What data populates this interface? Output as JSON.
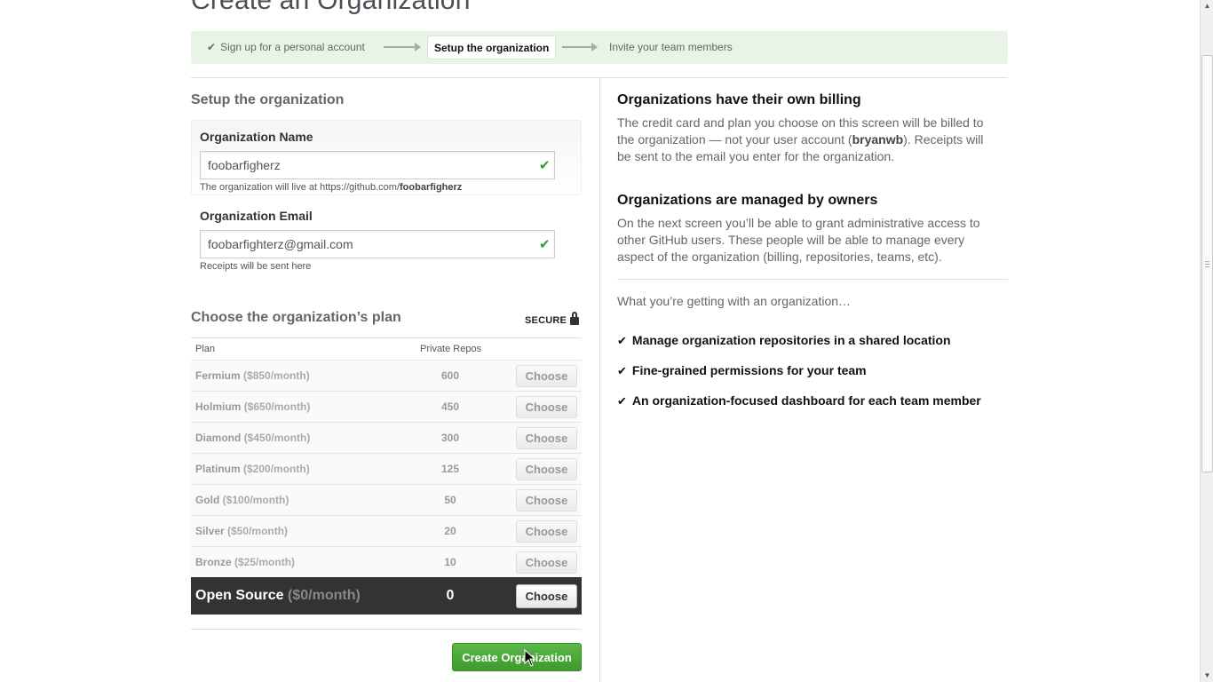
{
  "page": {
    "title": "Create an Organization"
  },
  "steps": {
    "step1": "Sign up for a personal account",
    "step2": "Setup the organization",
    "step3": "Invite your team members"
  },
  "setup": {
    "heading": "Setup the organization",
    "org_name": {
      "label": "Organization Name",
      "value": "foobarfigherz",
      "note_prefix": "The organization will live at https://github.com/",
      "note_slug": "foobarfigherz"
    },
    "org_email": {
      "label": "Organization Email",
      "value": "foobarfighterz@gmail.com",
      "note": "Receipts will be sent here"
    }
  },
  "plans": {
    "heading": "Choose the organization’s plan",
    "secure_label": "SECURE",
    "col_plan": "Plan",
    "col_repos": "Private Repos",
    "choose_label": "Choose",
    "rows": [
      {
        "name": "Fermium",
        "price": "($850/month)",
        "repos": "600"
      },
      {
        "name": "Holmium",
        "price": "($650/month)",
        "repos": "450"
      },
      {
        "name": "Diamond",
        "price": "($450/month)",
        "repos": "300"
      },
      {
        "name": "Platinum",
        "price": "($200/month)",
        "repos": "125"
      },
      {
        "name": "Gold",
        "price": "($100/month)",
        "repos": "50"
      },
      {
        "name": "Silver",
        "price": "($50/month)",
        "repos": "20"
      },
      {
        "name": "Bronze",
        "price": "($25/month)",
        "repos": "10"
      },
      {
        "name": "Open Source",
        "price": "($0/month)",
        "repos": "0"
      }
    ],
    "create_label": "Create Organization"
  },
  "info": {
    "billing_heading": "Organizations have their own billing",
    "billing_text_1": "The credit card and plan you choose on this screen will be billed to the organization — not your user account (",
    "billing_user": "bryanwb",
    "billing_text_2": "). Receipts will be sent to the email you enter for the organization.",
    "owners_heading": "Organizations are managed by owners",
    "owners_text": "On the next screen you’ll be able to grant administrative access to other GitHub users. These people will be able to manage every aspect of the organization (billing, repositories, teams, etc).",
    "getting": "What you’re getting with an organization…",
    "features": [
      "Manage organization repositories in a shared location",
      "Fine-grained permissions for your team",
      "An organization-focused dashboard for each team member"
    ]
  },
  "icons": {
    "check": "check-icon",
    "lock": "lock-icon",
    "arrow": "arrow-right-icon"
  },
  "colors": {
    "steps_bg": "#e8f4e5",
    "create_button": "#4aa83a",
    "open_source_row": "#333333",
    "valid_check": "#2aa12a"
  }
}
